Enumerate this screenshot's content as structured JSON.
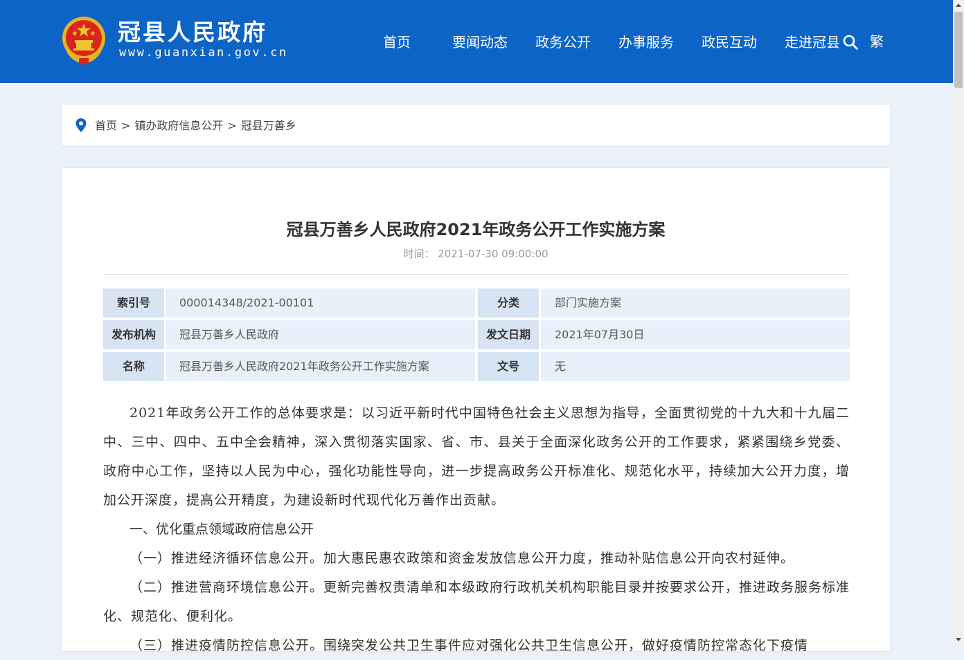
{
  "header": {
    "site_name": "冠县人民政府",
    "site_url": "www.guanxian.gov.cn",
    "nav": [
      "首页",
      "要闻动态",
      "政务公开",
      "办事服务",
      "政民互动",
      "走进冠县"
    ],
    "traditional_label": "繁",
    "background_color": "#0c64c6"
  },
  "breadcrumb": {
    "items": [
      "首页",
      "镇办政府信息公开",
      "冠县万善乡"
    ],
    "separator": ">"
  },
  "article": {
    "title": "冠县万善乡人民政府2021年政务公开工作实施方案",
    "time_label": "时间：",
    "time_value": "2021-07-30 09:00:00",
    "meta": {
      "index_label": "索引号",
      "index_value": "000014348/2021-00101",
      "category_label": "分类",
      "category_value": "部门实施方案",
      "publisher_label": "发布机构",
      "publisher_value": "冠县万善乡人民政府",
      "date_label": "发文日期",
      "date_value": "2021年07月30日",
      "name_label": "名称",
      "name_value": "冠县万善乡人民政府2021年政务公开工作实施方案",
      "doc_no_label": "文号",
      "doc_no_value": "无"
    },
    "paragraphs": [
      "2021年政务公开工作的总体要求是：以习近平新时代中国特色社会主义思想为指导，全面贯彻党的十九大和十九届二中、三中、四中、五中全会精神，深入贯彻落实国家、省、市、县关于全面深化政务公开的工作要求，紧紧围绕乡党委、政府中心工作，坚持以人民为中心，强化功能性导向，进一步提高政务公开标准化、规范化水平，持续加大公开力度，增加公开深度，提高公开精度，为建设新时代现代化万善作出贡献。",
      "一、优化重点领域政府信息公开",
      "（一）推进经济循环信息公开。加大惠民惠农政策和资金发放信息公开力度，推动补贴信息公开向农村延伸。",
      "（二）推进营商环境信息公开。更新完善权责清单和本级政府行政机关机构职能目录并按要求公开，推进政务服务标准化、规范化、便利化。",
      "（三）推进疫情防控信息公开。围绕突发公共卫生事件应对强化公共卫生信息公开，做好疫情防控常态化下疫情"
    ]
  }
}
